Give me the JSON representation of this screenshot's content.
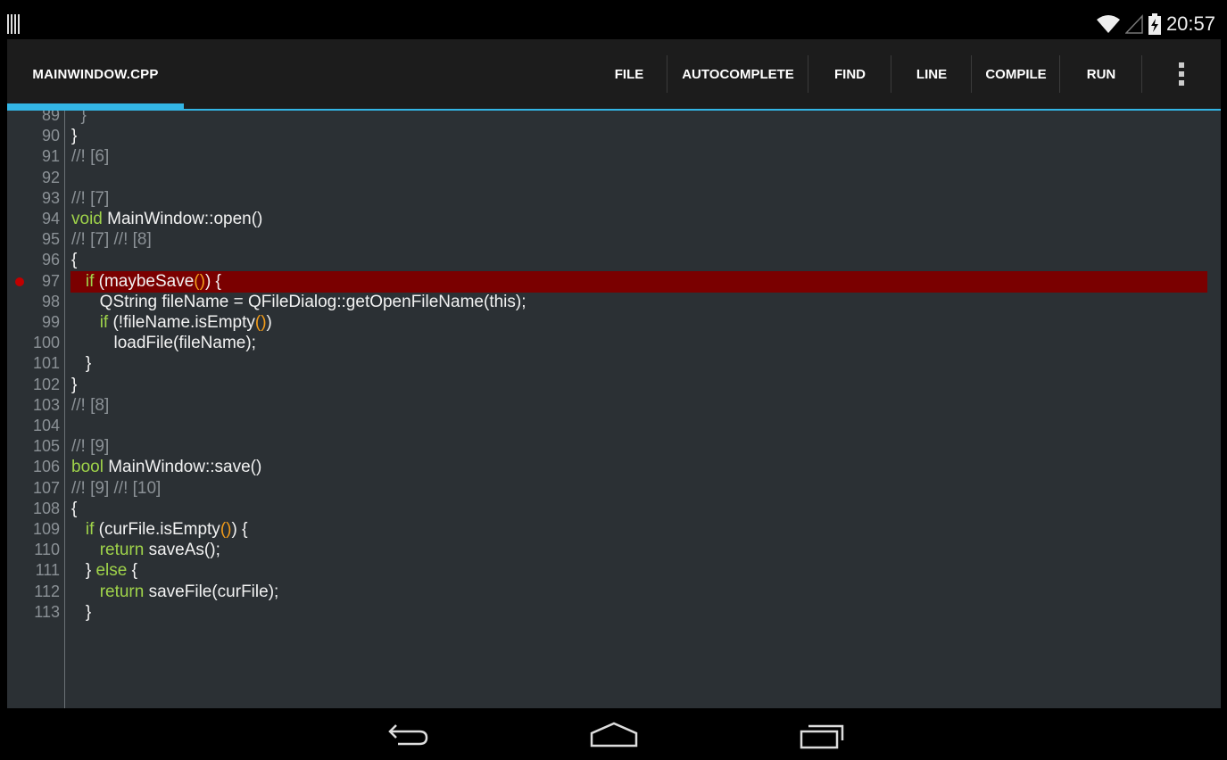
{
  "status_bar": {
    "time": "20:57",
    "icons": [
      "barcode-icon",
      "wifi-icon",
      "signal-icon",
      "battery-charging-icon"
    ]
  },
  "action_bar": {
    "tab_title": "MAINWINDOW.CPP",
    "actions": [
      "FILE",
      "AUTOCOMPLETE",
      "FIND",
      "LINE",
      "COMPILE",
      "RUN"
    ],
    "overflow_icon": "overflow-menu-icon",
    "accent_color": "#33b5e5"
  },
  "editor": {
    "background": "#2b3034",
    "highlight_color": "#7a0000",
    "breakpoint_line": "97",
    "lines": [
      {
        "num": "89",
        "tokens": [
          {
            "t": "  }",
            "c": "cm"
          }
        ]
      },
      {
        "num": "90",
        "tokens": [
          {
            "t": "}",
            "c": ""
          }
        ]
      },
      {
        "num": "91",
        "tokens": [
          {
            "t": "//! [6]",
            "c": "cm"
          }
        ]
      },
      {
        "num": "92",
        "tokens": []
      },
      {
        "num": "93",
        "tokens": [
          {
            "t": "//! [7]",
            "c": "cm"
          }
        ]
      },
      {
        "num": "94",
        "tokens": [
          {
            "t": "void",
            "c": "kw"
          },
          {
            "t": " MainWindow::open()",
            "c": ""
          }
        ]
      },
      {
        "num": "95",
        "tokens": [
          {
            "t": "//! [7] //! [8]",
            "c": "cm"
          }
        ]
      },
      {
        "num": "96",
        "tokens": [
          {
            "t": "{",
            "c": ""
          }
        ]
      },
      {
        "num": "97",
        "highlight": true,
        "tokens": [
          {
            "t": "   ",
            "c": ""
          },
          {
            "t": "if",
            "c": "kw"
          },
          {
            "t": " (maybeSave",
            "c": ""
          },
          {
            "t": "()",
            "c": "pr"
          },
          {
            "t": ") {",
            "c": ""
          }
        ]
      },
      {
        "num": "98",
        "tokens": [
          {
            "t": "      QString fileName = QFileDialog::getOpenFileName(this);",
            "c": ""
          }
        ]
      },
      {
        "num": "99",
        "tokens": [
          {
            "t": "      ",
            "c": ""
          },
          {
            "t": "if",
            "c": "kw"
          },
          {
            "t": " (!fileName.isEmpty",
            "c": ""
          },
          {
            "t": "()",
            "c": "pr"
          },
          {
            "t": ")",
            "c": ""
          }
        ]
      },
      {
        "num": "100",
        "tokens": [
          {
            "t": "         loadFile(fileName);",
            "c": ""
          }
        ]
      },
      {
        "num": "101",
        "tokens": [
          {
            "t": "   }",
            "c": ""
          }
        ]
      },
      {
        "num": "102",
        "tokens": [
          {
            "t": "}",
            "c": ""
          }
        ]
      },
      {
        "num": "103",
        "tokens": [
          {
            "t": "//! [8]",
            "c": "cm"
          }
        ]
      },
      {
        "num": "104",
        "tokens": []
      },
      {
        "num": "105",
        "tokens": [
          {
            "t": "//! [9]",
            "c": "cm"
          }
        ]
      },
      {
        "num": "106",
        "tokens": [
          {
            "t": "bool",
            "c": "kw"
          },
          {
            "t": " MainWindow::save()",
            "c": ""
          }
        ]
      },
      {
        "num": "107",
        "tokens": [
          {
            "t": "//! [9] //! [10]",
            "c": "cm"
          }
        ]
      },
      {
        "num": "108",
        "tokens": [
          {
            "t": "{",
            "c": ""
          }
        ]
      },
      {
        "num": "109",
        "tokens": [
          {
            "t": "   ",
            "c": ""
          },
          {
            "t": "if",
            "c": "kw"
          },
          {
            "t": " (curFile.isEmpty",
            "c": ""
          },
          {
            "t": "()",
            "c": "pr"
          },
          {
            "t": ") {",
            "c": ""
          }
        ]
      },
      {
        "num": "110",
        "tokens": [
          {
            "t": "      ",
            "c": ""
          },
          {
            "t": "return",
            "c": "kw"
          },
          {
            "t": " saveAs();",
            "c": ""
          }
        ]
      },
      {
        "num": "111",
        "tokens": [
          {
            "t": "   } ",
            "c": ""
          },
          {
            "t": "else",
            "c": "kw"
          },
          {
            "t": " {",
            "c": ""
          }
        ]
      },
      {
        "num": "112",
        "tokens": [
          {
            "t": "      ",
            "c": ""
          },
          {
            "t": "return",
            "c": "kw"
          },
          {
            "t": " saveFile(curFile);",
            "c": ""
          }
        ]
      },
      {
        "num": "113",
        "tokens": [
          {
            "t": "   }",
            "c": ""
          }
        ]
      }
    ]
  },
  "nav_bar": {
    "buttons": [
      "back-icon",
      "home-icon",
      "recent-apps-icon"
    ]
  }
}
